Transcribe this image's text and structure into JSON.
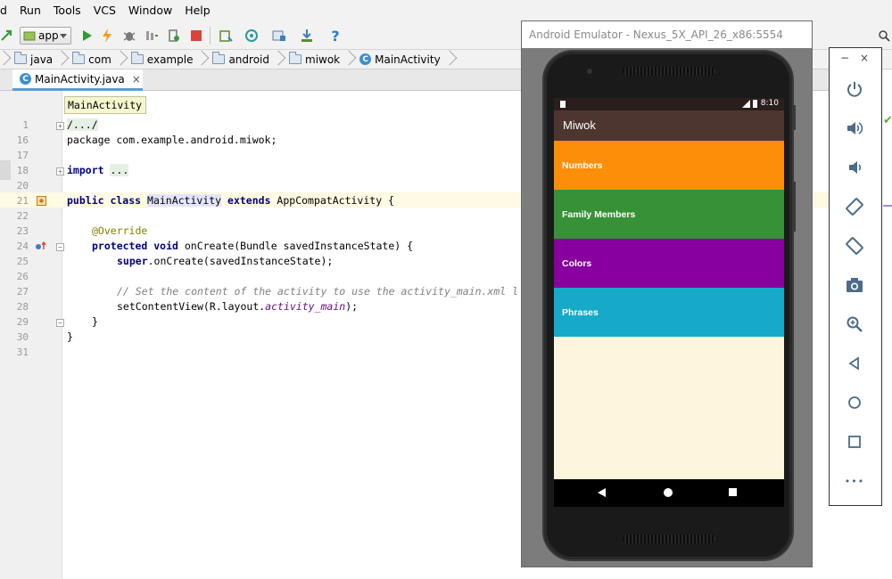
{
  "menu": {
    "items": [
      "d",
      "Run",
      "Tools",
      "VCS",
      "Window",
      "Help"
    ]
  },
  "toolbar": {
    "run_config": "app",
    "help_glyph": "?"
  },
  "breadcrumb": {
    "items": [
      "java",
      "com",
      "example",
      "android",
      "miwok",
      "MainActivity"
    ]
  },
  "tab": {
    "label": "MainActivity.java",
    "close_glyph": "×"
  },
  "tooltip": {
    "text": "MainActivity"
  },
  "editor": {
    "line_numbers": [
      "1",
      "16",
      "17",
      "18",
      "20",
      "21",
      "22",
      "23",
      "24",
      "25",
      "26",
      "27",
      "28",
      "29",
      "30",
      "31"
    ],
    "lines": {
      "l1": "/.../",
      "l16": "package com.example.android.miwok;",
      "l18_kw": "import",
      "l18_fold": "...",
      "l21_kw1": "public class ",
      "l21_cls": "MainActivity",
      "l21_kw2": " extends ",
      "l21_rest": "AppCompatActivity {",
      "l23": "@Override",
      "l24_kw": "protected void ",
      "l24_rest": "onCreate(Bundle savedInstanceState) {",
      "l25_kw": "super",
      "l25_rest": ".onCreate(savedInstanceState);",
      "l27": "// Set the content of the activity to use the activity_main.xml l",
      "l28_pre": "setContentView(R.layout.",
      "l28_fld": "activity_main",
      "l28_post": ");",
      "l29": "}",
      "l30": "}"
    }
  },
  "emulator": {
    "title": "Android Emulator - Nexus_5X_API_26_x86:5554",
    "status_time": "8:10",
    "app_title": "Miwok",
    "categories": [
      {
        "label": "Numbers",
        "color": "#fd8e09"
      },
      {
        "label": "Family Members",
        "color": "#379237"
      },
      {
        "label": "Colors",
        "color": "#8800a0"
      },
      {
        "label": "Phrases",
        "color": "#16aac8"
      }
    ],
    "screen_bg": "#fdf6dc",
    "appbar_color": "#4e3630"
  },
  "controls": {
    "minimize_glyph": "−",
    "close_glyph": "×",
    "more_glyph": "•••",
    "buttons": [
      "power-icon",
      "volume-up-icon",
      "volume-down-icon",
      "rotate-left-icon",
      "rotate-right-icon",
      "camera-icon",
      "zoom-icon",
      "back-icon",
      "home-icon",
      "overview-icon",
      "more-icon"
    ]
  }
}
